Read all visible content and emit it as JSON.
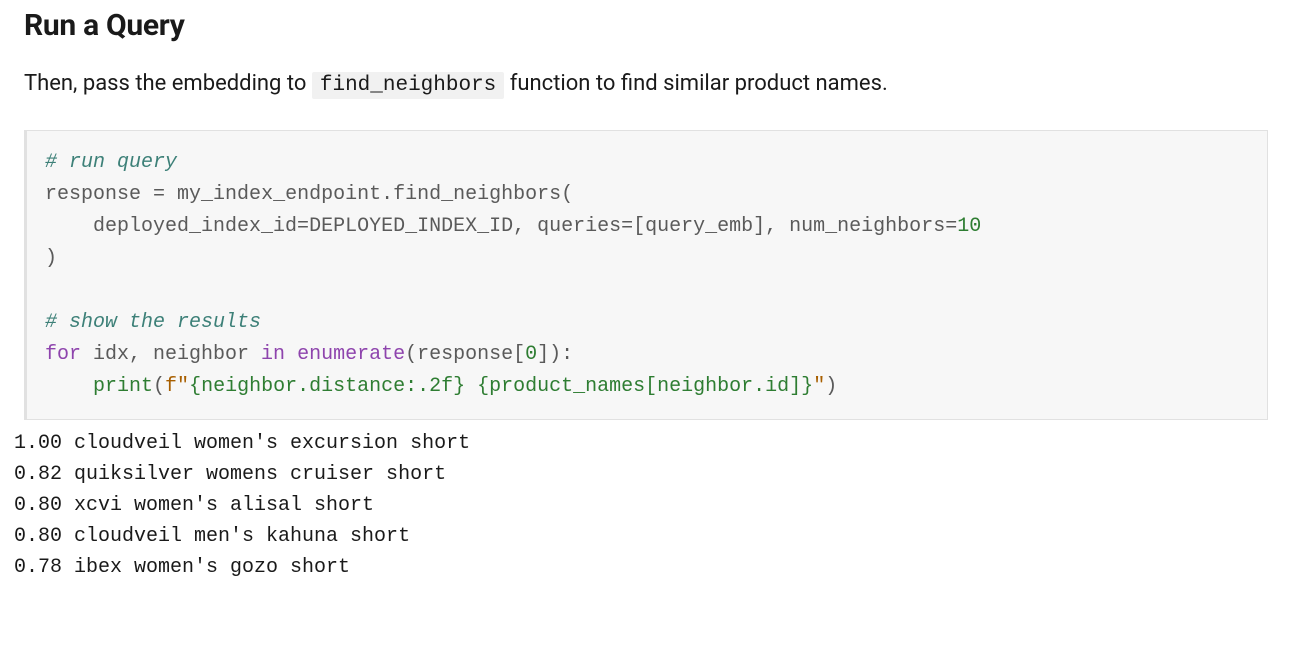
{
  "heading": "Run a Query",
  "description": {
    "before": "Then, pass the embedding to ",
    "code": "find_neighbors",
    "after": " function to find similar product names."
  },
  "code": {
    "comment1": "# run query",
    "line2_a": "response ",
    "line2_b": "=",
    "line2_c": " my_index_endpoint",
    "line2_d": ".",
    "line2_e": "find_neighbors(",
    "line3_a": "    deployed_index_id",
    "line3_b": "=",
    "line3_c": "DEPLOYED_INDEX_ID, queries",
    "line3_d": "=",
    "line3_e": "[query_emb], num_neighbors",
    "line3_f": "=",
    "line3_num": "10",
    "line4": ")",
    "comment2": "# show the results",
    "line6_for": "for",
    "line6_a": " idx, neighbor ",
    "line6_in": "in",
    "line6_b": " ",
    "line6_enum": "enumerate",
    "line6_c": "(response[",
    "line6_zero": "0",
    "line6_d": "]):",
    "line7_indent": "    ",
    "line7_print": "print",
    "line7_a": "(",
    "line7_f": "f\"",
    "line7_b": "{neighbor.distance:.2f}",
    "line7_space": " ",
    "line7_c": "{product_names[neighbor.id]}",
    "line7_d": "\"",
    "line7_e": ")"
  },
  "output": "1.00 cloudveil women's excursion short\n0.82 quiksilver womens cruiser short\n0.80 xcvi women's alisal short\n0.80 cloudveil men's kahuna short\n0.78 ibex women's gozo short"
}
